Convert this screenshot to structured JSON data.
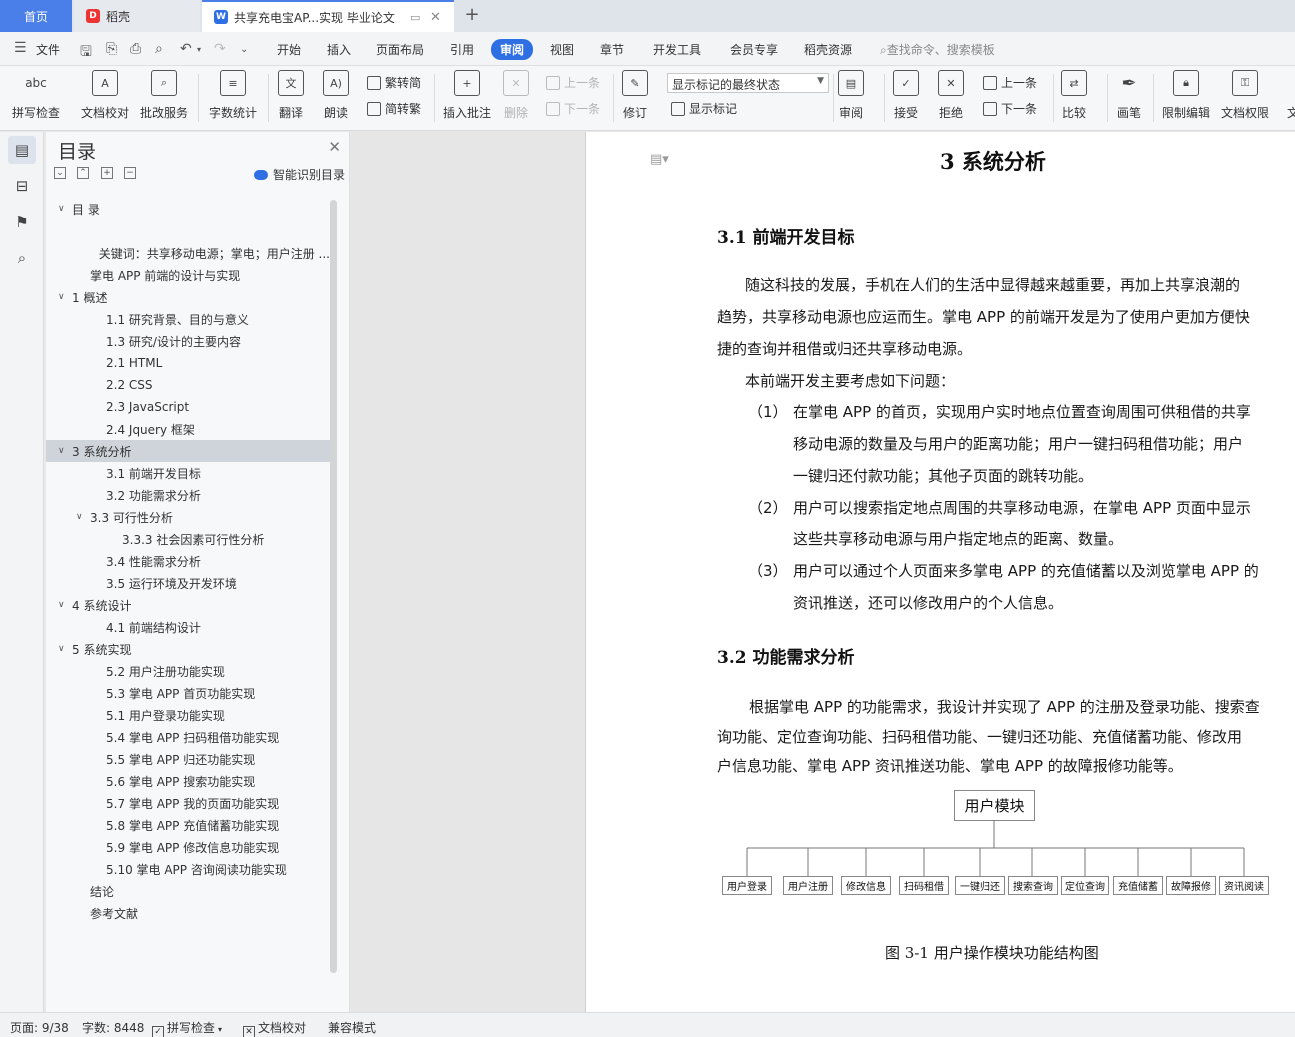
{
  "tabs": {
    "home": "首页",
    "daoke": "稻壳",
    "doc": "共享充电宝AP...实现 毕业论文",
    "new": "+"
  },
  "menu": {
    "file": "文件",
    "items": [
      "开始",
      "插入",
      "页面布局",
      "引用",
      "审阅",
      "视图",
      "章节",
      "开发工具",
      "会员专享",
      "稻壳资源"
    ],
    "active": "审阅",
    "search": "查找命令、搜索模板"
  },
  "ribbon": {
    "spell": "拼写检查",
    "proof": "文档校对",
    "batch": "批改服务",
    "wordcount": "字数统计",
    "translate": "翻译",
    "read": "朗读",
    "trad": "繁转简",
    "simp": "简转繁",
    "insert_comment": "插入批注",
    "delete": "删除",
    "prev_comment": "上一条",
    "next_comment": "下一条",
    "track": "修订",
    "markup_state": "显示标记的最终状态",
    "show_markup": "显示标记",
    "review": "审阅",
    "accept": "接受",
    "reject": "拒绝",
    "prev_change": "上一条",
    "next_change": "下一条",
    "compare": "比较",
    "pen": "画笔",
    "restrict": "限制编辑",
    "permission": "文档权限",
    "more": "文"
  },
  "toc": {
    "title": "目录",
    "smart": "智能识别目录",
    "items": [
      {
        "label": "目  录",
        "arrow": "∨",
        "indent": 0
      },
      {
        "label": "",
        "arrow": "",
        "indent": 2
      },
      {
        "label": "关键词：共享移动电源；掌电；用户注册 ...",
        "arrow": "",
        "indent": 2
      },
      {
        "label": "掌电 APP 前端的设计与实现",
        "arrow": "",
        "indent": 1
      },
      {
        "label": "1  概述",
        "arrow": "∨",
        "indent": 0
      },
      {
        "label": "1.1  研究背景、目的与意义",
        "arrow": "",
        "indent": 2
      },
      {
        "label": "1.3  研究/设计的主要内容",
        "arrow": "",
        "indent": 2
      },
      {
        "label": "2.1 HTML",
        "arrow": "",
        "indent": 2
      },
      {
        "label": "2.2 CSS",
        "arrow": "",
        "indent": 2
      },
      {
        "label": "2.3 JavaScript",
        "arrow": "",
        "indent": 2
      },
      {
        "label": "2.4 Jquery 框架",
        "arrow": "",
        "indent": 2
      },
      {
        "label": "3  系统分析",
        "arrow": "∨",
        "indent": 0,
        "selected": true
      },
      {
        "label": "3.1  前端开发目标",
        "arrow": "",
        "indent": 2
      },
      {
        "label": "3.2  功能需求分析",
        "arrow": "",
        "indent": 2
      },
      {
        "label": "3.3  可行性分析",
        "arrow": "∨",
        "indent": 1
      },
      {
        "label": "3.3.3  社会因素可行性分析",
        "arrow": "",
        "indent": 3
      },
      {
        "label": "3.4  性能需求分析",
        "arrow": "",
        "indent": 2
      },
      {
        "label": "3.5  运行环境及开发环境",
        "arrow": "",
        "indent": 2
      },
      {
        "label": "4  系统设计",
        "arrow": "∨",
        "indent": 0
      },
      {
        "label": "4.1  前端结构设计",
        "arrow": "",
        "indent": 2
      },
      {
        "label": "5  系统实现",
        "arrow": "∨",
        "indent": 0
      },
      {
        "label": "5.2  用户注册功能实现",
        "arrow": "",
        "indent": 2
      },
      {
        "label": "5.3  掌电 APP 首页功能实现",
        "arrow": "",
        "indent": 2
      },
      {
        "label": "5.1 用户登录功能实现",
        "arrow": "",
        "indent": 2
      },
      {
        "label": "5.4  掌电 APP 扫码租借功能实现",
        "arrow": "",
        "indent": 2
      },
      {
        "label": "5.5  掌电 APP 归还功能实现",
        "arrow": "",
        "indent": 2
      },
      {
        "label": "5.6  掌电 APP 搜索功能实现",
        "arrow": "",
        "indent": 2
      },
      {
        "label": "5.7  掌电 APP 我的页面功能实现",
        "arrow": "",
        "indent": 2
      },
      {
        "label": "5.8  掌电 APP 充值储蓄功能实现",
        "arrow": "",
        "indent": 2
      },
      {
        "label": "5.9  掌电 APP 修改信息功能实现",
        "arrow": "",
        "indent": 2
      },
      {
        "label": "5.10  掌电 APP 咨询阅读功能实现",
        "arrow": "",
        "indent": 2
      },
      {
        "label": "结论",
        "arrow": "",
        "indent": 1
      },
      {
        "label": "参考文献",
        "arrow": "",
        "indent": 1
      }
    ]
  },
  "doc": {
    "h1": "3  系统分析",
    "h2_1": "3.1  前端开发目标",
    "p1": [
      "随这科技的发展，手机在人们的生活中显得越来越重要，再加上共享浪潮的",
      "趋势，共享移动电源也应运而生。掌电 APP 的前端开发是为了使用户更加方便快",
      "捷的查询并租借或归还共享移动电源。"
    ],
    "p2": "本前端开发主要考虑如下问题：",
    "list": [
      {
        "num": "（1）",
        "lines": [
          "在掌电 APP 的首页，实现用户实时地点位置查询周围可供租借的共享",
          "移动电源的数量及与用户的距离功能；用户一键扫码租借功能；用户",
          "一键归还付款功能；其他子页面的跳转功能。"
        ]
      },
      {
        "num": "（2）",
        "lines": [
          "用户可以搜索指定地点周围的共享移动电源，在掌电 APP 页面中显示",
          "这些共享移动电源与用户指定地点的距离、数量。"
        ]
      },
      {
        "num": "（3）",
        "lines": [
          "用户可以通过个人页面来多掌电 APP 的充值储蓄以及浏览掌电 APP 的",
          "资讯推送，还可以修改用户的个人信息。"
        ]
      }
    ],
    "h2_2": "3.2  功能需求分析",
    "p3": [
      "根据掌电 APP 的功能需求，我设计并实现了 APP 的注册及登录功能、搜索查",
      "询功能、定位查询功能、扫码租借功能、一键归还功能、充值储蓄功能、修改用",
      "户信息功能、掌电 APP 资讯推送功能、掌电 APP 的故障报修功能等。"
    ],
    "diagram": {
      "root": "用户模块",
      "leaves": [
        "用户登录",
        "用户注册",
        "修改信息",
        "扫码租借",
        "一键归还",
        "搜索查询",
        "定位查询",
        "充值储蓄",
        "故障报修",
        "资讯阅读"
      ]
    },
    "caption": "图 3-1  用户操作模块功能结构图"
  },
  "status": {
    "page": "页面: 9/38",
    "words": "字数: 8448",
    "spell": "拼写检查",
    "proof": "文档校对",
    "compat": "兼容模式"
  }
}
